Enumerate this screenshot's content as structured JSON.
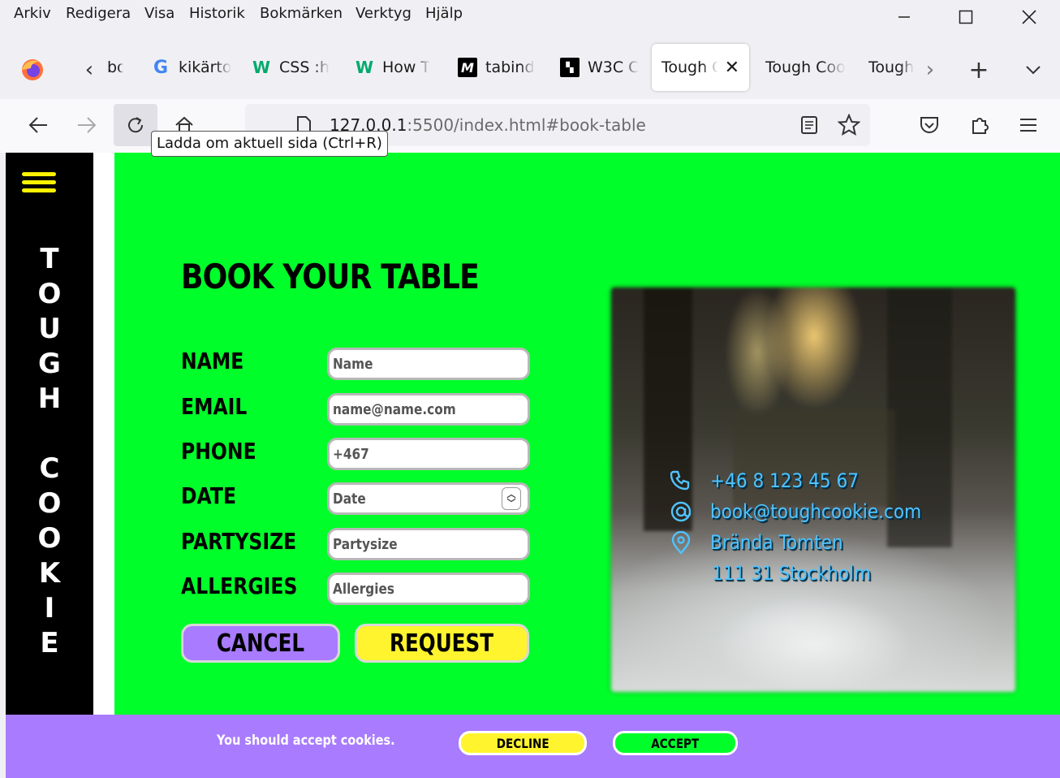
{
  "menubar": {
    "items": [
      "Arkiv",
      "Redigera",
      "Visa",
      "Historik",
      "Bokmärken",
      "Verktyg",
      "Hjälp"
    ]
  },
  "tabs": [
    {
      "label": "bo",
      "icon": "tab-scroll-left"
    },
    {
      "label": "kikärto",
      "icon": "google-icon"
    },
    {
      "label": "CSS :h",
      "icon": "w3schools-icon"
    },
    {
      "label": "How T",
      "icon": "w3schools-icon"
    },
    {
      "label": "tabind",
      "icon": "mdn-icon"
    },
    {
      "label": "W3C C",
      "icon": "w3c-icon"
    },
    {
      "label": "Tough C",
      "icon": "",
      "active": true
    },
    {
      "label": "Tough Coo",
      "icon": ""
    },
    {
      "label": "Tough",
      "icon": ""
    }
  ],
  "navbar": {
    "url_host": "127.0.0.1",
    "url_rest": ":5500/index.html#book-table",
    "tooltip": "Ladda om aktuell sida (Ctrl+R)"
  },
  "page": {
    "logo_lines": [
      "T",
      "O",
      "U",
      "G",
      "H",
      "",
      "C",
      "O",
      "O",
      "K",
      "I",
      "E"
    ],
    "heading": "BOOK YOUR TABLE",
    "fields": [
      {
        "label": "NAME",
        "placeholder": "Name"
      },
      {
        "label": "EMAIL",
        "placeholder": "name@name.com"
      },
      {
        "label": "PHONE",
        "placeholder": "+467"
      },
      {
        "label": "DATE",
        "placeholder": "Date"
      },
      {
        "label": "PARTYSIZE",
        "placeholder": "Partysize"
      },
      {
        "label": "ALLERGIES",
        "placeholder": "Allergies"
      }
    ],
    "cancel_label": "CANCEL",
    "request_label": "REQUEST",
    "contact": {
      "phone": "+46 8 123 45 67",
      "email": "book@toughcookie.com",
      "address1": "Brända Tomten",
      "address2": "111 31 Stockholm"
    }
  },
  "cookie": {
    "text": "You should accept cookies.",
    "decline_label": "DECLINE",
    "accept_label": "ACCEPT"
  },
  "colors": {
    "page_bg": "#00ff2a",
    "accent_purple": "#a87bff",
    "accent_yellow": "#fff42e",
    "contact_blue": "#4fc3ff"
  }
}
